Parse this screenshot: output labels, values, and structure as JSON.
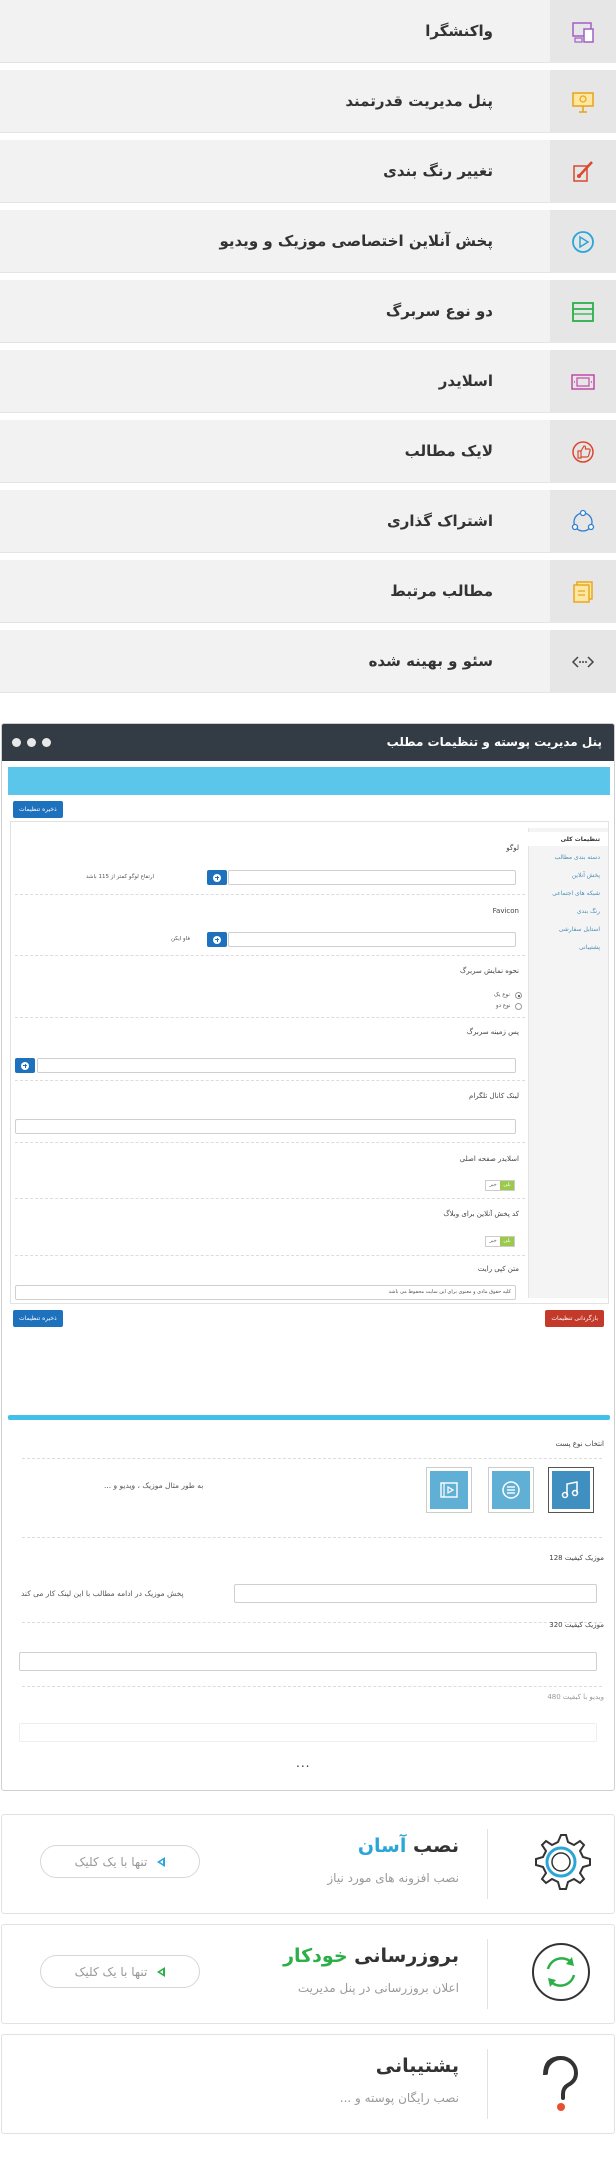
{
  "features": [
    {
      "label": "واکنشگرا",
      "icon": "responsive-devices-icon"
    },
    {
      "label": "پنل مدیریت قدرتمند",
      "icon": "presentation-board-icon"
    },
    {
      "label": "تغییر رنگ بندی",
      "icon": "color-brush-icon"
    },
    {
      "label": "پخش آنلاین اختصاصی موزیک و ویدیو",
      "icon": "play-circle-icon"
    },
    {
      "label": "دو نوع سربرگ",
      "icon": "header-layout-icon"
    },
    {
      "label": "اسلایدر",
      "icon": "slider-icon"
    },
    {
      "label": "لایک مطالب",
      "icon": "thumbs-up-icon"
    },
    {
      "label": "اشتراک گذاری",
      "icon": "share-icon"
    },
    {
      "label": "مطالب مرتبط",
      "icon": "related-posts-icon"
    },
    {
      "label": "سئو و بهینه شده",
      "icon": "code-seo-icon"
    }
  ],
  "panel": {
    "title": "پنل مدیریت پوسته و تنظیمات مطلب",
    "save_label": "ذخیره تنظیمات",
    "reset_label": "بازگردانی تنظیمات",
    "sidebar": [
      "تنظیمات کلی",
      "دسته بندی مطالب",
      "پخش آنلاین",
      "شبکه های اجتماعی",
      "رنگ بندی",
      "استایل سفارشی",
      "پشتیبانی"
    ],
    "fields": {
      "logo_label": "لوگو",
      "logo_hint": "ارتفاع لوگو کمتر از 115 باشد",
      "favicon_label": "Favicon",
      "favicon_hint": "فاو ایکن",
      "header_mode_label": "نحوه نمایش سربرگ",
      "header_option_1": "نوع یک",
      "header_option_2": "نوع دو",
      "header_bg_label": "پس زمینه سربرگ",
      "telegram_label": "لینک کانال تلگرام",
      "main_slider_label": "اسلایدر صفحه اصلی",
      "weblog_player_label": "کد پخش آنلاین برای وبلاگ",
      "yes": "بلی",
      "no": "خیر",
      "copyright_label": "متن کپی رایت",
      "copyright_value": "کلیه حقوق مادی و معنوی برای این سایت محفوظ می باشد"
    },
    "post_type_label": "انتخاب نوع پست",
    "post_type_hint": "به طور مثال موزیک ، ویدیو و ...",
    "music_128_label": "موزیک کیفیت 128",
    "music_128_hint": "پخش موزیک در ادامه مطالب با این لینک کار می کند",
    "music_320_label": "موزیک کیفیت 320",
    "video_480_label": "ویدیو با کیفیت 480",
    "more": "..."
  },
  "cards": [
    {
      "title_main": "نصب",
      "title_highlight": "آسان",
      "subtitle": "نصب افزونه های مورد نیاز",
      "button": "تنها با یک کلیک",
      "icon": "gear-icon"
    },
    {
      "title_main": "بروزرسانی",
      "title_highlight": "خودکار",
      "subtitle": "اعلان بروزرسانی در پنل مدیریت",
      "button": "تنها با یک کلیک",
      "icon": "sync-arrows-icon"
    },
    {
      "title_main": "پشتیبانی",
      "title_highlight": "",
      "subtitle": "نصب رایگان پوسته و ...",
      "icon": "support-question-icon"
    }
  ],
  "colors": {
    "accent_blue": "#2aa6d8",
    "accent_green": "#2bb048",
    "panel_header": "#333b44",
    "save_button": "#1e72bd",
    "reset_button": "#c43a2a"
  }
}
